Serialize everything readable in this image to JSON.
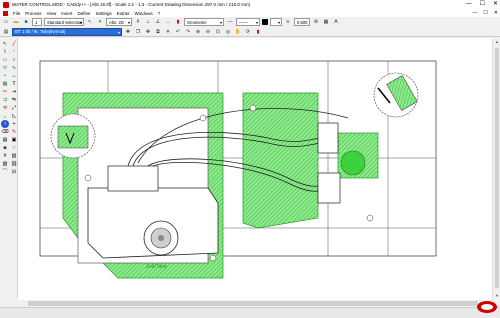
{
  "window": {
    "title": "WATER CONTROL.MOD - CADdy++ - [Alls 15:3f] - Scale 1:2 - 1:3 - Current Drawing Dimension 297.0 mm / 210.0 mm)",
    "buttons": [
      "—",
      "☐",
      "✕"
    ]
  },
  "menu": {
    "items": [
      "File",
      "Process",
      "View",
      "Insert",
      "Define",
      "Settings",
      "Extras",
      "Windows",
      "?"
    ],
    "mdi_buttons": [
      "—",
      "☐",
      "✕"
    ]
  },
  "toolbar1": {
    "layer_value": "1",
    "selection_mode": "Standard Selection",
    "abs_label": "Abs. 2D",
    "geometry": "Geometrie",
    "line_width": "0,500"
  },
  "toolbar2": {
    "active_element": "BT: 1 00 / IK: Teile(thermal)"
  },
  "drawing": {
    "dial_label": "Zeit/Time"
  },
  "colors": {
    "accent_blue": "#2a6fd6",
    "hatch_green": "#3ed13e"
  }
}
